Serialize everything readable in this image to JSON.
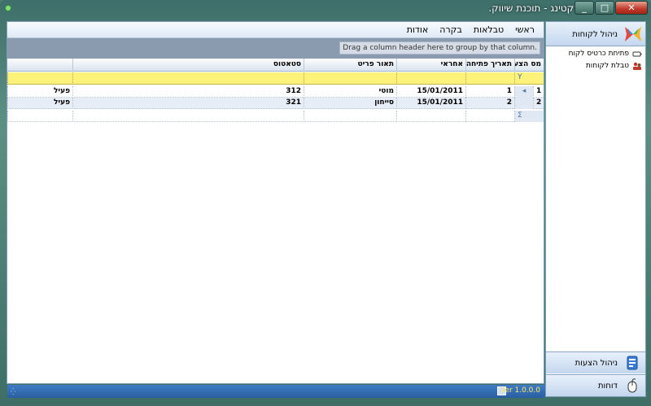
{
  "window": {
    "title": "מרקטינג - תוכנת שיווק."
  },
  "menu": [
    "ראשי",
    "טבלאות",
    "בקרה",
    "אודות"
  ],
  "grid": {
    "group_hint": "Drag a column header here to group by that column.",
    "columns": [
      "מס הצעה",
      "תאריך פתיחה",
      "אחראי",
      "תאור פריט",
      "סטאטוס"
    ],
    "rows": [
      {
        "num": "1",
        "id": "1",
        "date": "15/01/2011",
        "owner": "מוטי",
        "item": "312",
        "status": "פעיל"
      },
      {
        "num": "2",
        "id": "2",
        "date": "15/01/2011",
        "owner": "סייחון",
        "item": "321",
        "status": "פעיל"
      }
    ],
    "sum_symbol": "Σ",
    "filter_symbol": "Y"
  },
  "sidebar": {
    "header": "ניהול לקוחות",
    "items": [
      "פתיחת כרטיס לקוח",
      "טבלת לקוחות"
    ],
    "bottom": [
      "ניהול הצעות",
      "דוחות"
    ]
  },
  "status": {
    "version": "Ver 1.0.0.0"
  },
  "colors": {
    "filter_row": "#fff27a",
    "status_bar": "#2a5ea0",
    "version_text": "#ffe96a"
  }
}
